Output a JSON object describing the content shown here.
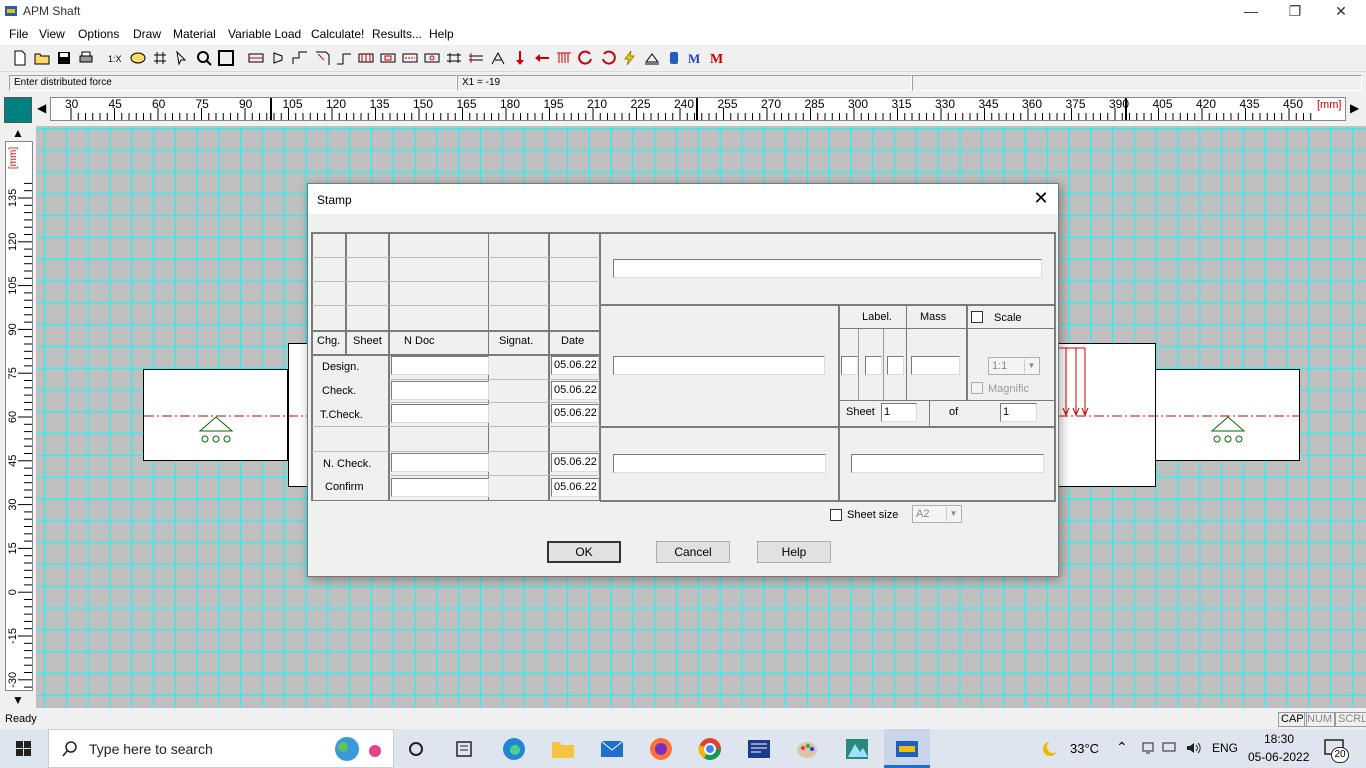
{
  "app": {
    "title": "APM Shaft"
  },
  "window_controls": {
    "minimize": "—",
    "maximize": "❐",
    "close": "✕"
  },
  "menu": [
    "File",
    "View",
    "Options",
    "Draw",
    "Material",
    "Variable Load",
    "Calculate!",
    "Results...",
    "Help"
  ],
  "status_row": {
    "prompt": "Enter distributed force",
    "coord": "X1 = -19"
  },
  "hruler": {
    "ticks": [
      "30",
      "45",
      "60",
      "75",
      "90",
      "105",
      "120",
      "135",
      "150",
      "165",
      "180",
      "195",
      "210",
      "225",
      "240",
      "255",
      "270",
      "285",
      "300",
      "315",
      "330",
      "345",
      "360",
      "375",
      "390",
      "405",
      "420",
      "435",
      "450"
    ],
    "unit": "[mm]"
  },
  "vruler": {
    "ticks": [
      "135",
      "120",
      "105",
      "90",
      "75",
      "60",
      "45",
      "30",
      "15",
      "0",
      "-15",
      "-30"
    ],
    "unit": "[mm]"
  },
  "status_bar": {
    "text": "Ready",
    "indicators": [
      "CAP",
      "NUM",
      "SCRL"
    ]
  },
  "taskbar": {
    "search_placeholder": "Type here to search",
    "temperature": "33°C",
    "language": "ENG",
    "time": "18:30",
    "date": "05-06-2022",
    "notifications": "20"
  },
  "dialog": {
    "title": "Stamp",
    "headers": {
      "chg": "Chg.",
      "sheet": "Sheet",
      "ndoc": "N Doc",
      "signat": "Signat.",
      "date": "Date"
    },
    "rows": [
      {
        "label": "Design.",
        "date": "05.06.22"
      },
      {
        "label": "Check.",
        "date": "05.06.22"
      },
      {
        "label": "T.Check.",
        "date": "05.06.22"
      },
      {
        "label": "N. Check.",
        "date": "05.06.22"
      },
      {
        "label": "Confirm",
        "date": "05.06.22"
      }
    ],
    "label_header": "Label.",
    "mass_header": "Mass",
    "scale_label": "Scale",
    "scale_value": "1:1",
    "magnific_label": "Magnific",
    "sheet_label": "Sheet",
    "sheet_value": "1",
    "of_label": "of",
    "of_value": "1",
    "sheet_size_label": "Sheet size",
    "sheet_size_value": "A2",
    "buttons": {
      "ok": "OK",
      "cancel": "Cancel",
      "help": "Help"
    }
  },
  "colors": {
    "grid": "#00ffff",
    "canvas": "#c0c0c0",
    "accent": "#008080",
    "load": "#cc0000"
  }
}
